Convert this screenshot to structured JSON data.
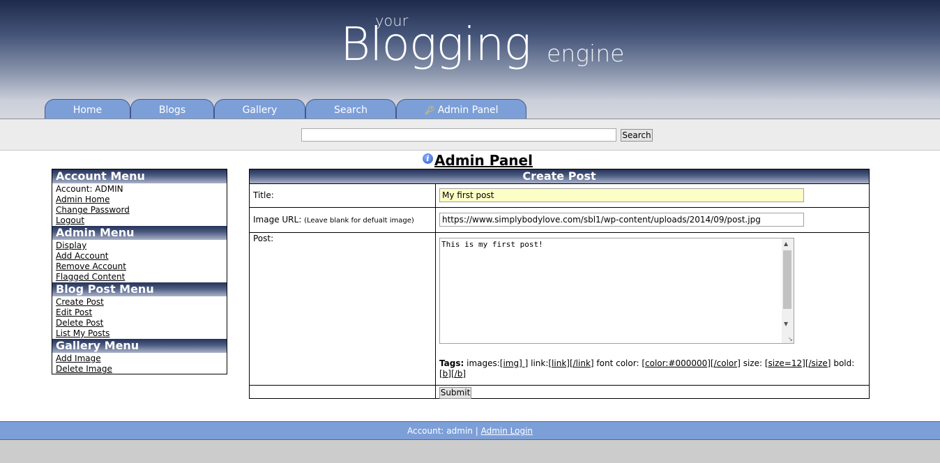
{
  "logo": {
    "your": "your",
    "blogging": "Blogging",
    "engine": "engine"
  },
  "nav": {
    "tabs": [
      {
        "label": "Home"
      },
      {
        "label": "Blogs"
      },
      {
        "label": "Gallery"
      },
      {
        "label": "Search"
      },
      {
        "label": "Admin Panel",
        "icon": "key-icon"
      }
    ]
  },
  "search": {
    "value": "",
    "button_label": "Search"
  },
  "page_title": "Admin Panel",
  "sidebar": {
    "account_menu": {
      "title": "Account Menu",
      "account_label": "Account: ADMIN",
      "items": [
        "Admin Home",
        "Change Password",
        "Logout"
      ]
    },
    "admin_menu": {
      "title": "Admin Menu",
      "items": [
        "Display",
        "Add Account",
        "Remove Account",
        "Flagged Content"
      ]
    },
    "blog_post_menu": {
      "title": "Blog Post Menu",
      "items": [
        "Create Post",
        "Edit Post",
        "Delete Post",
        "List My Posts"
      ]
    },
    "gallery_menu": {
      "title": "Gallery Menu",
      "items": [
        "Add Image",
        "Delete Image"
      ]
    }
  },
  "form": {
    "header": "Create Post",
    "title_label": "Title:",
    "title_value": "My first post",
    "image_label": "Image URL:",
    "image_hint": "(Leave blank for defualt image)",
    "image_value": "https://www.simplybodylove.com/sbl1/wp-content/uploads/2014/09/post.jpg",
    "post_label": "Post:",
    "post_value": "This is my first post!",
    "tags": {
      "label": "Tags:",
      "images_label": "images:",
      "images_tag": "[img] ]",
      "link_label": "link:",
      "link_tag": "[link][/link]",
      "color_label": "font color:",
      "color_tag": "[color:#000000][/color]",
      "size_label": "size:",
      "size_tag": "[size=12][/size]",
      "bold_label": "bold:",
      "bold_tag": "[b][/b]"
    },
    "submit_label": "Submit"
  },
  "footer": {
    "account_text": "Account: admin",
    "separator": "|",
    "login_link": "Admin Login"
  },
  "colors": {
    "tab_blue": "#7d9fd8",
    "menu_header_dark": "#253257",
    "title_field_bg": "#fdfdc6"
  }
}
